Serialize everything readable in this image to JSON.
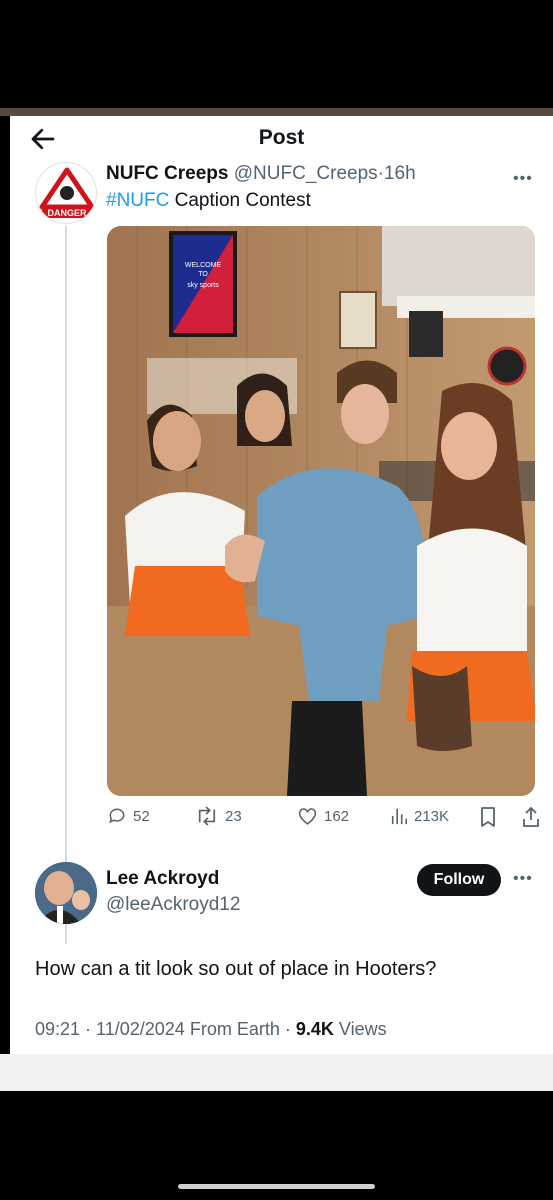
{
  "header": {
    "title": "Post"
  },
  "tweet": {
    "avatar_label": "DANGER",
    "display_name": "NUFC Creeps",
    "handle": "@NUFC_Creeps",
    "separator": "·",
    "time": "16h",
    "hashtag": "#NUFC",
    "text": " Caption Contest",
    "photo_sign": [
      "WELCOME",
      "TO",
      "sky sports"
    ],
    "actions": {
      "replies": "52",
      "retweets": "23",
      "likes": "162",
      "views": "213K"
    }
  },
  "reply": {
    "display_name": "Lee Ackroyd",
    "handle": "@leeAckroyd12",
    "follow_label": "Follow",
    "text": "How can a tit look so out of place in Hooters?",
    "time": "09:21",
    "date": "11/02/2024",
    "source": "From Earth",
    "views_count": "9.4K",
    "views_label": "Views"
  },
  "colors": {
    "link": "#1d9bf0",
    "secondary": "#536471",
    "text": "#0f1419"
  }
}
